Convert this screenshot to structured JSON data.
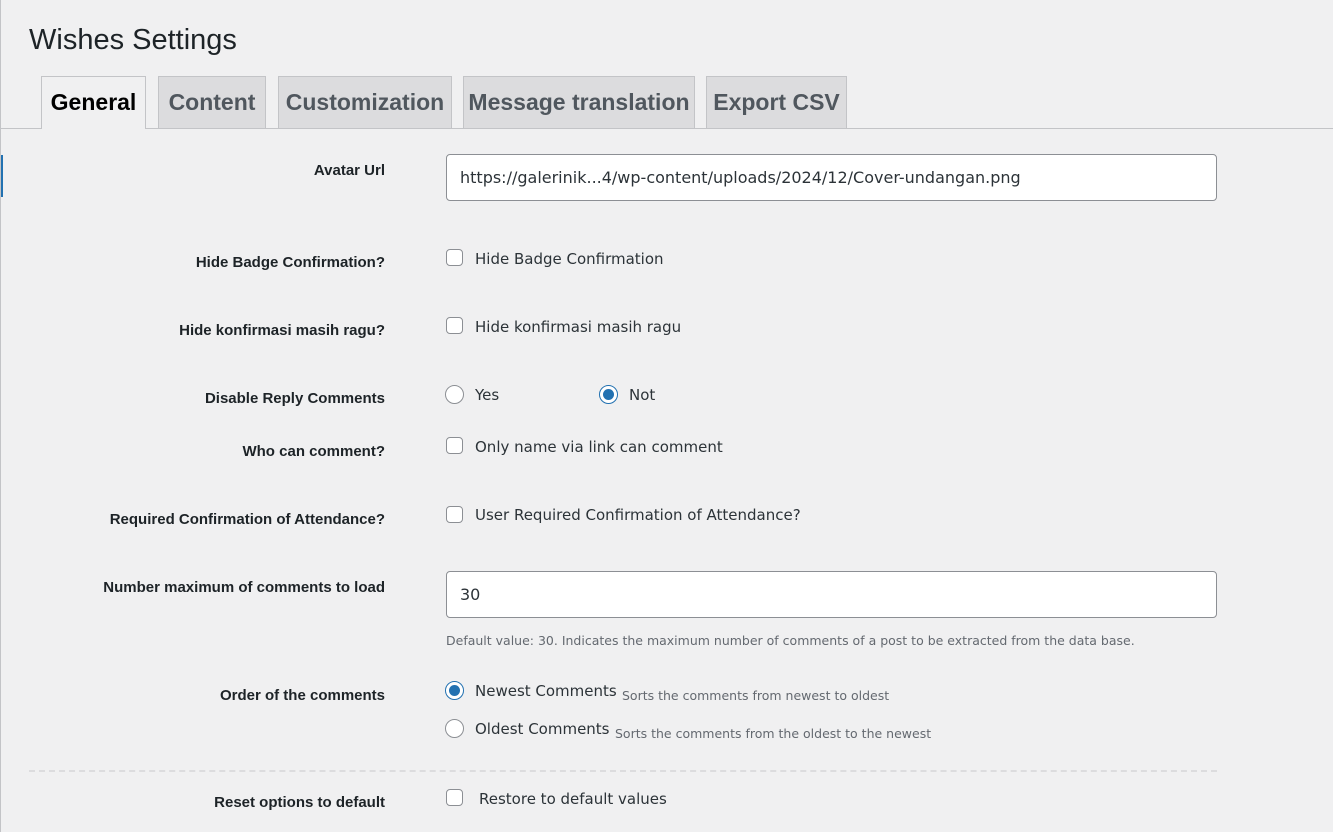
{
  "page": {
    "title": "Wishes Settings"
  },
  "tabs": [
    {
      "label": "General",
      "active": true
    },
    {
      "label": "Content",
      "active": false
    },
    {
      "label": "Customization",
      "active": false
    },
    {
      "label": "Message translation",
      "active": false
    },
    {
      "label": "Export CSV",
      "active": false
    }
  ],
  "fields": {
    "avatar_url": {
      "label": "Avatar Url",
      "value": "https://galerinik...4/wp-content/uploads/2024/12/Cover-undangan.png"
    },
    "hide_badge": {
      "label": "Hide Badge Confirmation?",
      "option": "Hide Badge Confirmation",
      "checked": false
    },
    "hide_ragu": {
      "label": "Hide konfirmasi masih ragu?",
      "option": "Hide konfirmasi masih ragu",
      "checked": false
    },
    "disable_reply": {
      "label": "Disable Reply Comments",
      "options": [
        {
          "label": "Yes",
          "checked": false
        },
        {
          "label": "Not",
          "checked": true
        }
      ]
    },
    "who_can_comment": {
      "label": "Who can comment?",
      "option": "Only name via link can comment",
      "checked": false
    },
    "required_attendance": {
      "label": "Required Confirmation of Attendance?",
      "option": "User Required Confirmation of Attendance?",
      "checked": false
    },
    "max_comments": {
      "label": "Number maximum of comments to load",
      "value": "30",
      "hint": "Default value: 30. Indicates the maximum number of comments of a post to be extracted from the data base."
    },
    "order": {
      "label": "Order of the comments",
      "options": [
        {
          "label": "Newest Comments",
          "hint": "Sorts the comments from newest to oldest",
          "checked": true
        },
        {
          "label": "Oldest Comments",
          "hint": "Sorts the comments from the oldest to the newest",
          "checked": false
        }
      ]
    },
    "reset": {
      "label": "Reset options to default",
      "option": "Restore to default values",
      "checked": false
    }
  },
  "colors": {
    "accent": "#2271b1",
    "background": "#f0f0f1",
    "tab_inactive": "#dcdcde",
    "border": "#c3c4c7"
  }
}
